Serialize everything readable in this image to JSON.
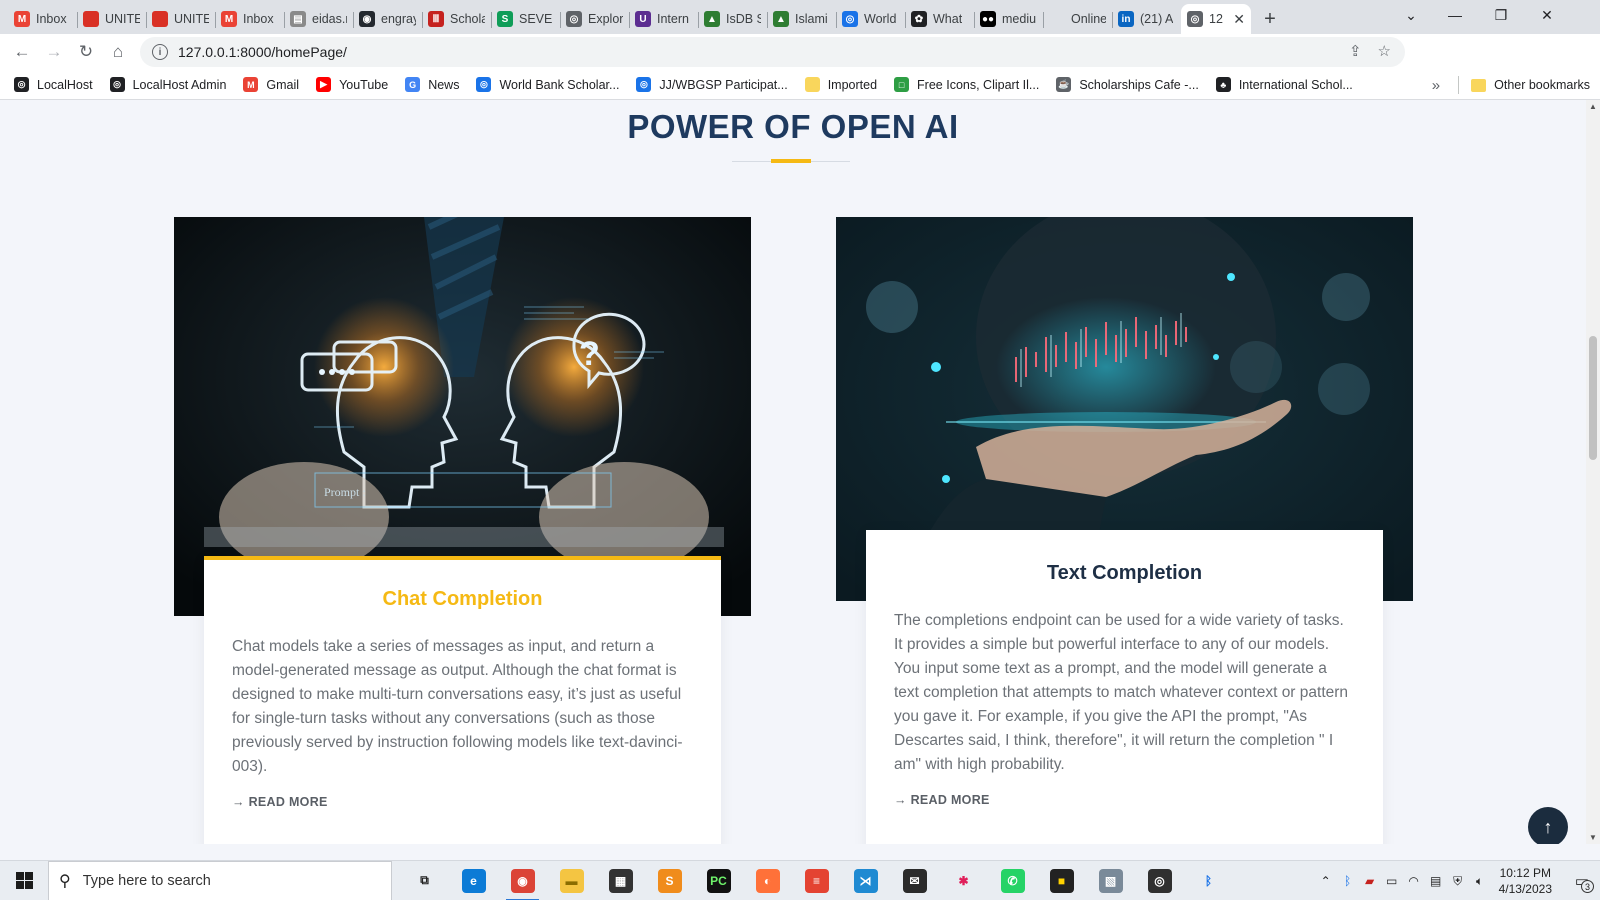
{
  "browser": {
    "tabs": [
      {
        "label": "Inbox",
        "icon": "gmail-icon",
        "color": "#ea4335",
        "glyph": "M"
      },
      {
        "label": "UNITE",
        "icon": "globe-red-icon",
        "color": "#d93025",
        "glyph": ""
      },
      {
        "label": "UNITE",
        "icon": "globe-red-icon",
        "color": "#d93025",
        "glyph": ""
      },
      {
        "label": "Inbox",
        "icon": "gmail-icon",
        "color": "#ea4335",
        "glyph": "M"
      },
      {
        "label": "eidas.r",
        "icon": "document-icon",
        "color": "#8a8a8a",
        "glyph": "▤"
      },
      {
        "label": "engray",
        "icon": "github-icon",
        "color": "#24292f",
        "glyph": "◉"
      },
      {
        "label": "Schola",
        "icon": "bars-icon",
        "color": "#c5221f",
        "glyph": "Ⅲ"
      },
      {
        "label": "SEVE C",
        "icon": "seve-icon",
        "color": "#0f9d58",
        "glyph": "S"
      },
      {
        "label": "Explor",
        "icon": "globe-icon",
        "color": "#5f6368",
        "glyph": "◎"
      },
      {
        "label": "Intern",
        "icon": "u-icon",
        "color": "#5c2d91",
        "glyph": "U"
      },
      {
        "label": "IsDB S",
        "icon": "isdb-icon",
        "color": "#2e7d32",
        "glyph": "▲"
      },
      {
        "label": "Islami",
        "icon": "isdb-icon",
        "color": "#2e7d32",
        "glyph": "▲"
      },
      {
        "label": "World",
        "icon": "globe-blue-icon",
        "color": "#1a73e8",
        "glyph": "◎"
      },
      {
        "label": "What",
        "icon": "openai-icon",
        "color": "#202124",
        "glyph": "✿"
      },
      {
        "label": "mediu",
        "icon": "medium-icon",
        "color": "#000000",
        "glyph": "●●"
      },
      {
        "label": "Online",
        "icon": "blank-icon",
        "color": "#dee1e6",
        "glyph": ""
      },
      {
        "label": "(21) A",
        "icon": "linkedin-icon",
        "color": "#0a66c2",
        "glyph": "in"
      },
      {
        "label": "12",
        "icon": "globe-icon",
        "color": "#5f6368",
        "glyph": "◎"
      }
    ],
    "url": "127.0.0.1:8000/homePage/",
    "bookmarks": [
      {
        "label": "LocalHost",
        "icon": "globe-icon",
        "color": "#202124",
        "glyph": "◎"
      },
      {
        "label": "LocalHost Admin",
        "icon": "globe-icon",
        "color": "#202124",
        "glyph": "◎"
      },
      {
        "label": "Gmail",
        "icon": "gmail-icon",
        "color": "#ea4335",
        "glyph": "M"
      },
      {
        "label": "YouTube",
        "icon": "youtube-icon",
        "color": "#ff0000",
        "glyph": "▶"
      },
      {
        "label": "News",
        "icon": "news-icon",
        "color": "#4285f4",
        "glyph": "G"
      },
      {
        "label": "World Bank Scholar...",
        "icon": "globe-blue-icon",
        "color": "#1a73e8",
        "glyph": "◎"
      },
      {
        "label": "JJ/WBGSP Participat...",
        "icon": "globe-blue-icon",
        "color": "#1a73e8",
        "glyph": "◎"
      },
      {
        "label": "Imported",
        "icon": "folder-icon",
        "color": "#f9d65c",
        "glyph": ""
      },
      {
        "label": "Free Icons, Clipart Il...",
        "icon": "icons-icon",
        "color": "#2e9e44",
        "glyph": "□"
      },
      {
        "label": "Scholarships Cafe -...",
        "icon": "cafe-icon",
        "color": "#5f6368",
        "glyph": "☕"
      },
      {
        "label": "International Schol...",
        "icon": "person-icon",
        "color": "#202124",
        "glyph": "♣"
      }
    ],
    "overflow": "»",
    "other_bookmarks": "Other bookmarks"
  },
  "section": {
    "title": "POWER OF OPEN AI"
  },
  "cards": [
    {
      "title": "Chat Completion",
      "text": "Chat models take a series of messages as input, and return a model-generated message as output. Although the chat format is designed to make multi-turn conversations easy, it’s just as useful for single-turn tasks without any conversations (such as those previously served by instruction following models like text-davinci-003).",
      "read_more": "→ READ MORE",
      "image_prompt_label": "Prompt :",
      "title_color": "#f5b914"
    },
    {
      "title": "Text Completion",
      "text": "The completions endpoint can be used for a wide variety of tasks. It provides a simple but powerful interface to any of our models. You input some text as a prompt, and the model will generate a text completion that attempts to match whatever context or pattern you gave it. For example, if you give the API the prompt, \"As Descartes said, I think, therefore\", it will return the completion \" I am\" with high probability.",
      "read_more": "→ READ MORE",
      "title_color": "#1e2f45"
    }
  ],
  "back_to_top": "↑",
  "taskbar": {
    "search_placeholder": "Type here to search",
    "apps": [
      {
        "name": "task-view-icon",
        "color": "#e9edf2",
        "glyph": "⧉",
        "fg": "#222"
      },
      {
        "name": "edge-icon",
        "color": "#0c7bd6",
        "glyph": "e",
        "fg": "#fff"
      },
      {
        "name": "chrome-icon",
        "color": "#db4437",
        "glyph": "◉",
        "fg": "#fff",
        "running": true
      },
      {
        "name": "file-explorer-icon",
        "color": "#f4c542",
        "glyph": "▬",
        "fg": "#8a6d00"
      },
      {
        "name": "store-icon",
        "color": "#333333",
        "glyph": "▦",
        "fg": "#fff"
      },
      {
        "name": "sublime-icon",
        "color": "#f08c1c",
        "glyph": "S",
        "fg": "#fff"
      },
      {
        "name": "pycharm-icon",
        "color": "#111111",
        "glyph": "PC",
        "fg": "#6ff26b"
      },
      {
        "name": "firefox-icon",
        "color": "#ff7139",
        "glyph": "◐",
        "fg": "#fff"
      },
      {
        "name": "todoist-icon",
        "color": "#e44332",
        "glyph": "≡",
        "fg": "#fff"
      },
      {
        "name": "vscode-icon",
        "color": "#1f8ad2",
        "glyph": "⋊",
        "fg": "#fff"
      },
      {
        "name": "mail-icon",
        "color": "#2b2b2b",
        "glyph": "✉",
        "fg": "#fff"
      },
      {
        "name": "slack-icon",
        "color": "#e9edf2",
        "glyph": "✱",
        "fg": "#e01e5a"
      },
      {
        "name": "whatsapp-icon",
        "color": "#25d366",
        "glyph": "✆",
        "fg": "#fff"
      },
      {
        "name": "sticky-notes-icon",
        "color": "#222222",
        "glyph": "■",
        "fg": "#ffd200"
      },
      {
        "name": "photos-icon",
        "color": "#7a8a99",
        "glyph": "▧",
        "fg": "#fff"
      },
      {
        "name": "obs-icon",
        "color": "#303030",
        "glyph": "◎",
        "fg": "#fff"
      },
      {
        "name": "bluetooth-icon",
        "color": "#e9edf2",
        "glyph": "ᛒ",
        "fg": "#1a73e8"
      }
    ],
    "time": "10:12 PM",
    "date": "4/13/2023",
    "notification_count": "3"
  }
}
